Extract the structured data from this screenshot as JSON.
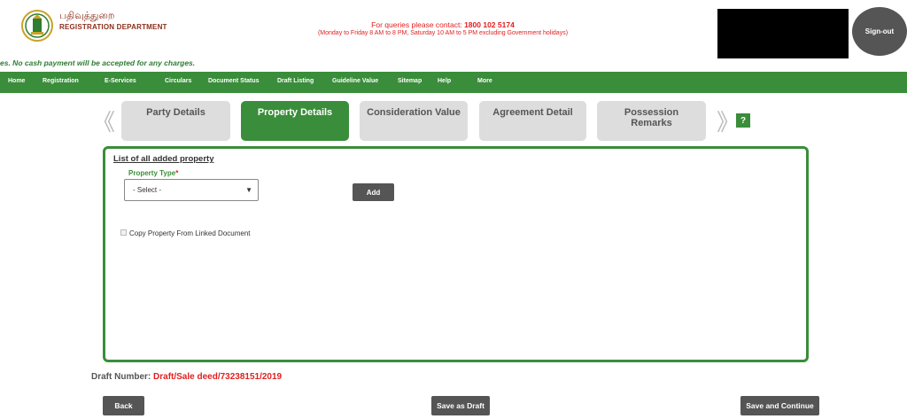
{
  "header": {
    "brand_tamil": "பதிவுத்துறை",
    "brand_english": "REGISTRATION DEPARTMENT",
    "contact_prefix": "For queries please contact:",
    "contact_number": "1800 102 5174",
    "contact_hours": "(Monday to Friday 8 AM to 8 PM, Saturday 10 AM to 5 PM excluding Government holidays)",
    "signout_label": "Sign-out"
  },
  "notice": "es. No cash payment will be accepted for any charges.",
  "nav": {
    "items": [
      "Home",
      "Registration",
      "E-Services",
      "Circulars",
      "Document Status",
      "Draft Listing",
      "Guideline Value",
      "Sitemap",
      "Help",
      "More"
    ]
  },
  "tabs": [
    {
      "label": "Party Details",
      "active": false
    },
    {
      "label": "Property Details",
      "active": true
    },
    {
      "label": "Consideration Value",
      "active": false
    },
    {
      "label": "Agreement Detail",
      "active": false
    },
    {
      "label": "Possession Remarks",
      "active": false
    }
  ],
  "help_label": "?",
  "arrows": {
    "prev": "《",
    "next": "》"
  },
  "property": {
    "list_title": "List of all added property",
    "type_label": "Property Type",
    "required_mark": "*",
    "select_value": "- Select -",
    "add_label": "Add",
    "copy_label": "Copy Property From Linked Document"
  },
  "draft": {
    "label": "Draft Number:",
    "value": "Draft/Sale deed/73238151/2019"
  },
  "buttons": {
    "back": "Back",
    "save_draft": "Save as Draft",
    "save_continue": "Save and Continue"
  },
  "colors": {
    "accent_green": "#3a8d3a",
    "alert_red": "#e02020",
    "button_gray": "#555555"
  }
}
